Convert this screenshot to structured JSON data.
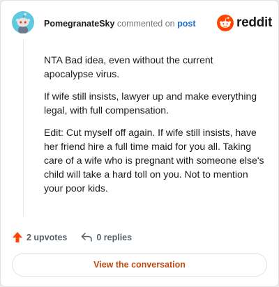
{
  "header": {
    "username": "PomegranateSky",
    "action_text": "commented on",
    "post_link": "post",
    "brand_name": "reddit"
  },
  "comment": {
    "paragraphs": [
      "NTA Bad idea, even without the current apocalypse virus.",
      "If wife still insists, lawyer up and make everything legal, with full compensation.",
      "Edit: Cut myself off again. If wife still insists, have her friend hire a full time maid for you all. Taking care of a wife who is pregnant with someone else's child will take a hard toll on you. Not to mention your poor kids."
    ]
  },
  "footer": {
    "upvotes": "2 upvotes",
    "replies": "0 replies"
  },
  "cta": {
    "label": "View the conversation"
  },
  "colors": {
    "brand_orange": "#ff4500",
    "upvote_orange": "#ff4500",
    "link_blue": "#1a6fd1",
    "cta_text": "#c04a13",
    "avatar_bg": "#5fc9e0"
  },
  "icons": {
    "avatar": "snoo-avatar-icon",
    "brand": "reddit-logo-icon",
    "upvote": "upvote-arrow-icon",
    "reply": "reply-arrow-icon"
  }
}
